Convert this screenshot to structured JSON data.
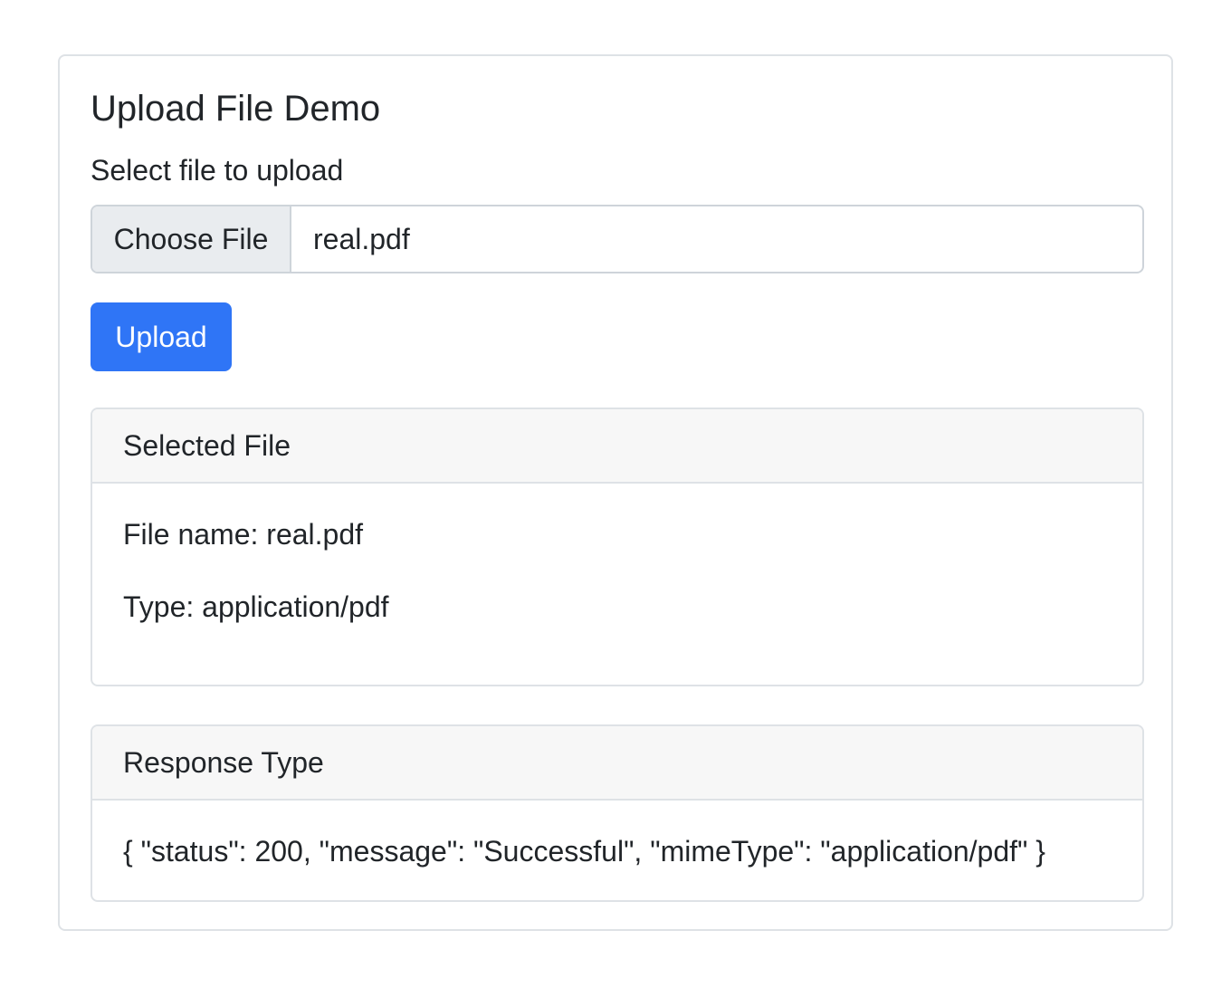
{
  "page": {
    "title": "Upload File Demo"
  },
  "upload_form": {
    "label": "Select file to upload",
    "choose_file_label": "Choose File",
    "selected_file_name": "real.pdf",
    "upload_button_label": "Upload"
  },
  "selected_file_card": {
    "header": "Selected File",
    "file_name_line": "File name: real.pdf",
    "type_line": "Type: application/pdf"
  },
  "response_card": {
    "header": "Response Type",
    "body": "{ \"status\": 200, \"message\": \"Successful\", \"mimeType\": \"application/pdf\" }"
  },
  "colors": {
    "primary_button": "#2f75f6",
    "border": "#dee2e6",
    "card_header_bg": "#f7f7f7",
    "file_button_bg": "#e9ecef"
  }
}
